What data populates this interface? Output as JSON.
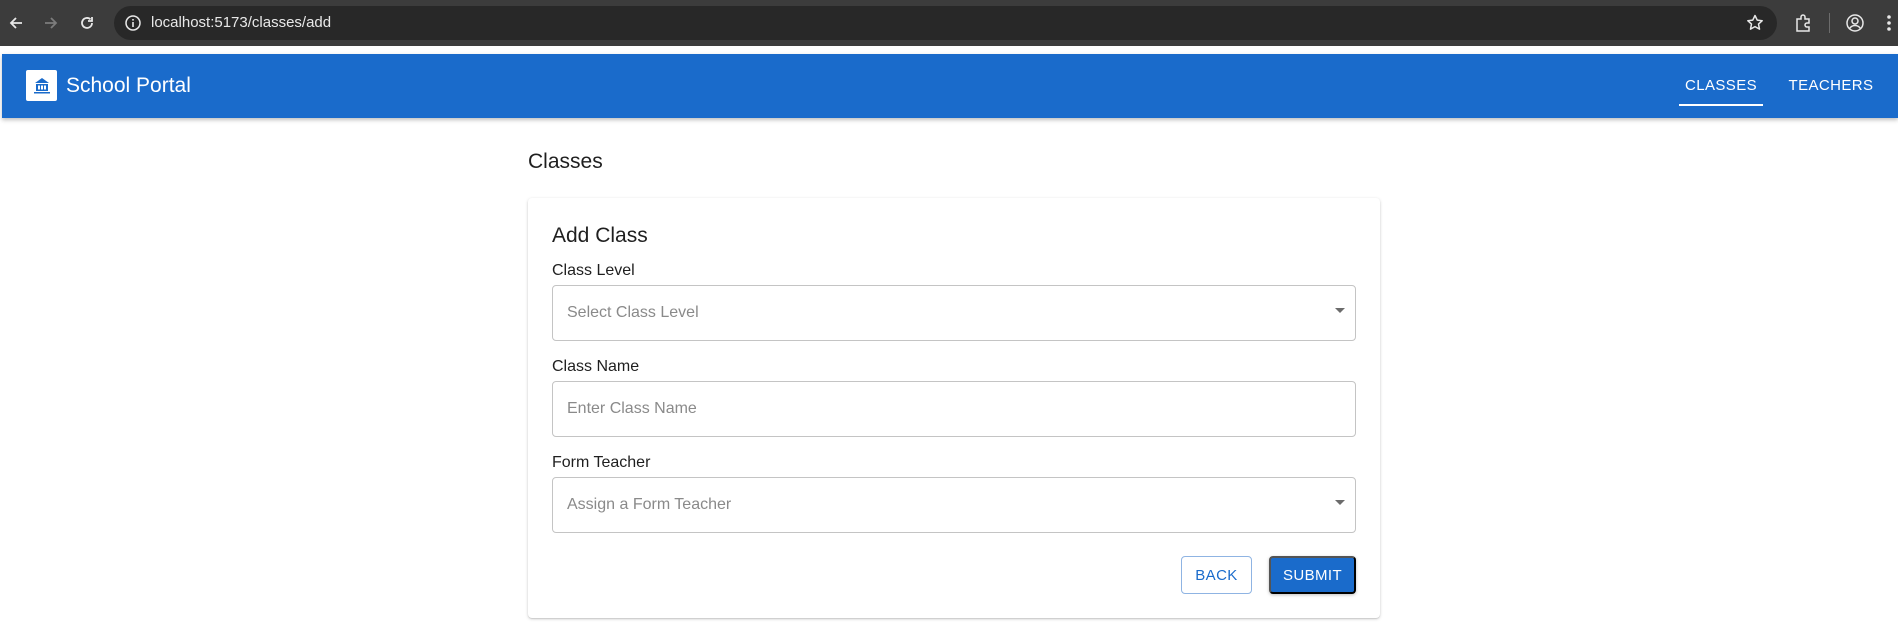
{
  "browser": {
    "url": "localhost:5173/classes/add"
  },
  "app": {
    "title": "School Portal",
    "nav": [
      {
        "label": "CLASSES",
        "active": true
      },
      {
        "label": "TEACHERS",
        "active": false
      }
    ],
    "accent_color": "#1a6bcb"
  },
  "page": {
    "title": "Classes"
  },
  "form": {
    "title": "Add Class",
    "class_level": {
      "label": "Class Level",
      "placeholder": "Select Class Level"
    },
    "class_name": {
      "label": "Class Name",
      "placeholder": "Enter Class Name"
    },
    "form_teacher": {
      "label": "Form Teacher",
      "placeholder": "Assign a Form Teacher"
    },
    "back_label": "BACK",
    "submit_label": "SUBMIT"
  }
}
